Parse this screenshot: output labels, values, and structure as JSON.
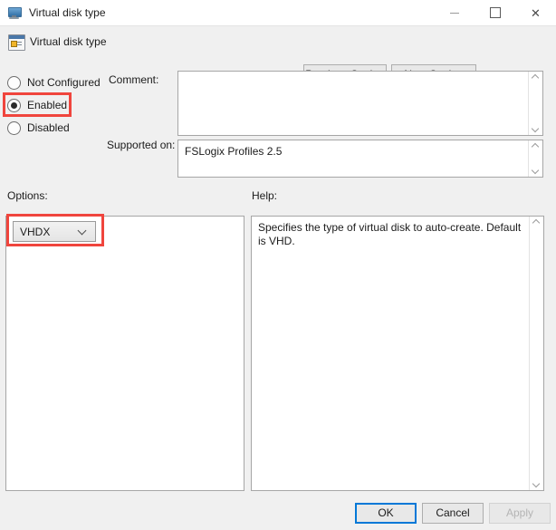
{
  "window": {
    "title": "Virtual disk type",
    "icon": "computer-icon",
    "controls": {
      "minimize": "minimize-icon",
      "maximize": "maximize-icon",
      "close": "✕"
    }
  },
  "header": {
    "title": "Virtual disk type",
    "icon": "policy-setting-icon",
    "previous_setting": "Previous Setting",
    "next_setting": "Next Setting"
  },
  "state_options": [
    {
      "label": "Not Configured",
      "selected": false
    },
    {
      "label": "Enabled",
      "selected": true
    },
    {
      "label": "Disabled",
      "selected": false
    }
  ],
  "comment": {
    "label": "Comment:",
    "value": ""
  },
  "supported_on": {
    "label": "Supported on:",
    "value": "FSLogix Profiles 2.5"
  },
  "options": {
    "label": "Options:",
    "combo": {
      "value": "VHDX",
      "arrow": "chevron-down-icon"
    }
  },
  "help": {
    "label": "Help:",
    "text": "Specifies the type of virtual disk to auto-create. Default is VHD."
  },
  "footer": {
    "ok": "OK",
    "cancel": "Cancel",
    "apply": "Apply"
  },
  "annotations": {
    "color": "#f0453d",
    "targets": [
      "Enabled",
      "VHDX"
    ]
  }
}
